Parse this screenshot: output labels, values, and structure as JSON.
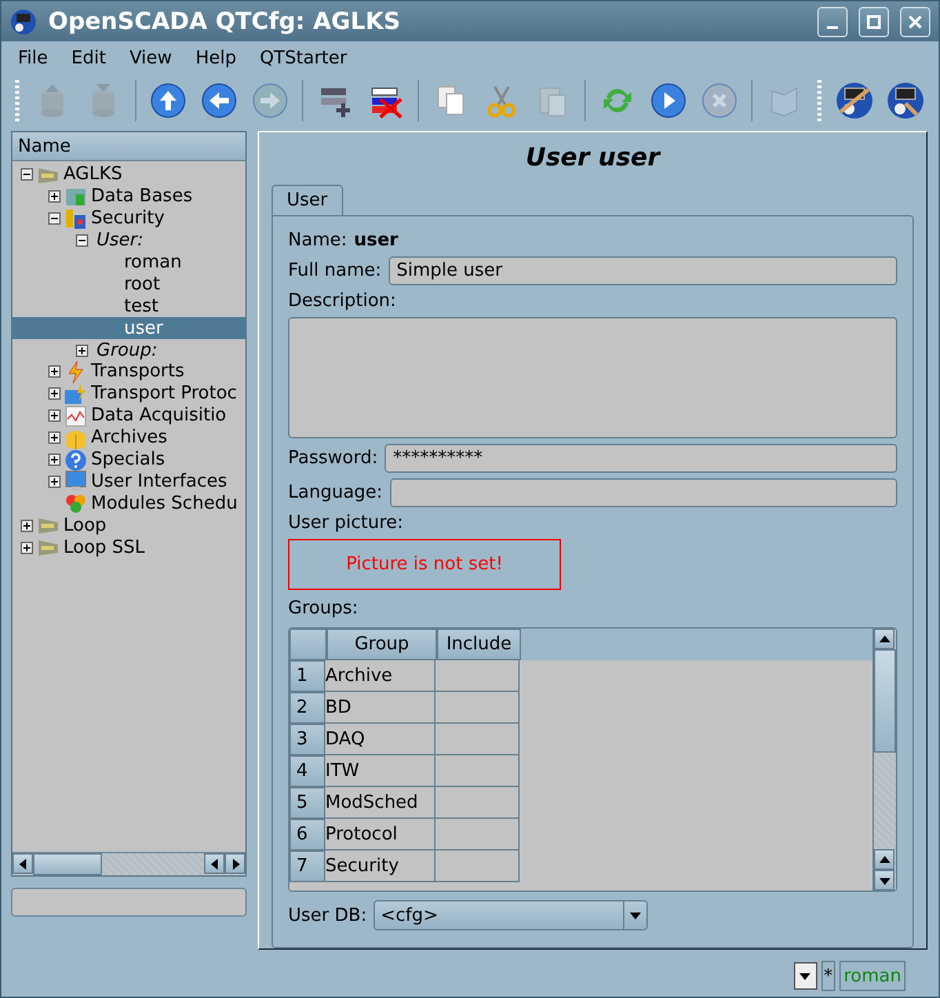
{
  "window": {
    "title": "OpenSCADA QTCfg: AGLKS"
  },
  "menu": [
    "File",
    "Edit",
    "View",
    "Help",
    "QTStarter"
  ],
  "toolbar": [
    {
      "kind": "handle"
    },
    {
      "kind": "db-load",
      "disabled": true
    },
    {
      "kind": "db-save",
      "disabled": true
    },
    {
      "kind": "separator"
    },
    {
      "kind": "up",
      "disabled": false
    },
    {
      "kind": "back",
      "disabled": false
    },
    {
      "kind": "forward",
      "disabled": true
    },
    {
      "kind": "separator"
    },
    {
      "kind": "add",
      "disabled": false
    },
    {
      "kind": "delete",
      "disabled": false
    },
    {
      "kind": "separator"
    },
    {
      "kind": "copy",
      "disabled": false
    },
    {
      "kind": "cut",
      "disabled": false
    },
    {
      "kind": "paste",
      "disabled": true
    },
    {
      "kind": "separator"
    },
    {
      "kind": "refresh",
      "disabled": false
    },
    {
      "kind": "start",
      "disabled": false
    },
    {
      "kind": "stop",
      "disabled": true
    },
    {
      "kind": "separator"
    },
    {
      "kind": "book",
      "disabled": true
    },
    {
      "kind": "handle"
    },
    {
      "kind": "tool",
      "disabled": false
    },
    {
      "kind": "tool2",
      "disabled": false
    }
  ],
  "tree": {
    "header": "Name",
    "items": [
      {
        "label": "AGLKS",
        "kind": "station",
        "expanded": true,
        "selected": false,
        "children": [
          {
            "label": "Data Bases",
            "kind": "db",
            "expanded": false,
            "selected": false
          },
          {
            "label": "Security",
            "kind": "security",
            "expanded": true,
            "selected": false,
            "children": [
              {
                "label": "User:",
                "kind": "group",
                "expanded": true,
                "selected": false,
                "children": [
                  {
                    "label": "roman",
                    "selected": false
                  },
                  {
                    "label": "root",
                    "selected": false
                  },
                  {
                    "label": "test",
                    "selected": false
                  },
                  {
                    "label": "user",
                    "selected": true
                  }
                ]
              },
              {
                "label": "Group:",
                "kind": "group",
                "expanded": false,
                "selected": false
              }
            ]
          },
          {
            "label": "Transports",
            "kind": "transport",
            "expanded": false,
            "selected": false
          },
          {
            "label": "Transport Protoc",
            "kind": "protocol",
            "expanded": false,
            "selected": false
          },
          {
            "label": "Data Acquisitio",
            "kind": "daq",
            "expanded": false,
            "selected": false
          },
          {
            "label": "Archives",
            "kind": "archive",
            "expanded": false,
            "selected": false
          },
          {
            "label": "Specials",
            "kind": "help",
            "expanded": false,
            "selected": false
          },
          {
            "label": "User Interfaces",
            "kind": "ui",
            "expanded": false,
            "selected": false
          },
          {
            "label": "Modules Schedu",
            "kind": "modules",
            "selected": false
          }
        ]
      },
      {
        "label": "Loop",
        "kind": "station",
        "expanded": false,
        "selected": false
      },
      {
        "label": "Loop SSL",
        "kind": "station",
        "expanded": false,
        "selected": false
      }
    ]
  },
  "page": {
    "title": "User user",
    "tabs": [
      {
        "label": "User",
        "selected": true
      }
    ],
    "name_label": "Name:",
    "name_value": "user",
    "full_name": {
      "label": "Full name:",
      "value": "Simple user"
    },
    "description": {
      "label": "Description:"
    },
    "password": {
      "label": "Password:",
      "value": "**********"
    },
    "language": {
      "label": "Language:"
    },
    "picture": {
      "label": "User picture:",
      "message": "Picture is not set!"
    },
    "groups": {
      "label": "Groups:",
      "columns": [
        "Group",
        "Include"
      ],
      "rows": [
        {
          "index": "1",
          "group": "Archive"
        },
        {
          "index": "2",
          "group": "BD"
        },
        {
          "index": "3",
          "group": "DAQ"
        },
        {
          "index": "4",
          "group": "ITW"
        },
        {
          "index": "5",
          "group": "ModSched"
        },
        {
          "index": "6",
          "group": "Protocol"
        },
        {
          "index": "7",
          "group": "Security"
        }
      ]
    },
    "user_db": {
      "label": "User DB:",
      "value": "<cfg>"
    }
  },
  "status_bar": {
    "modified": "*",
    "user": "roman"
  }
}
